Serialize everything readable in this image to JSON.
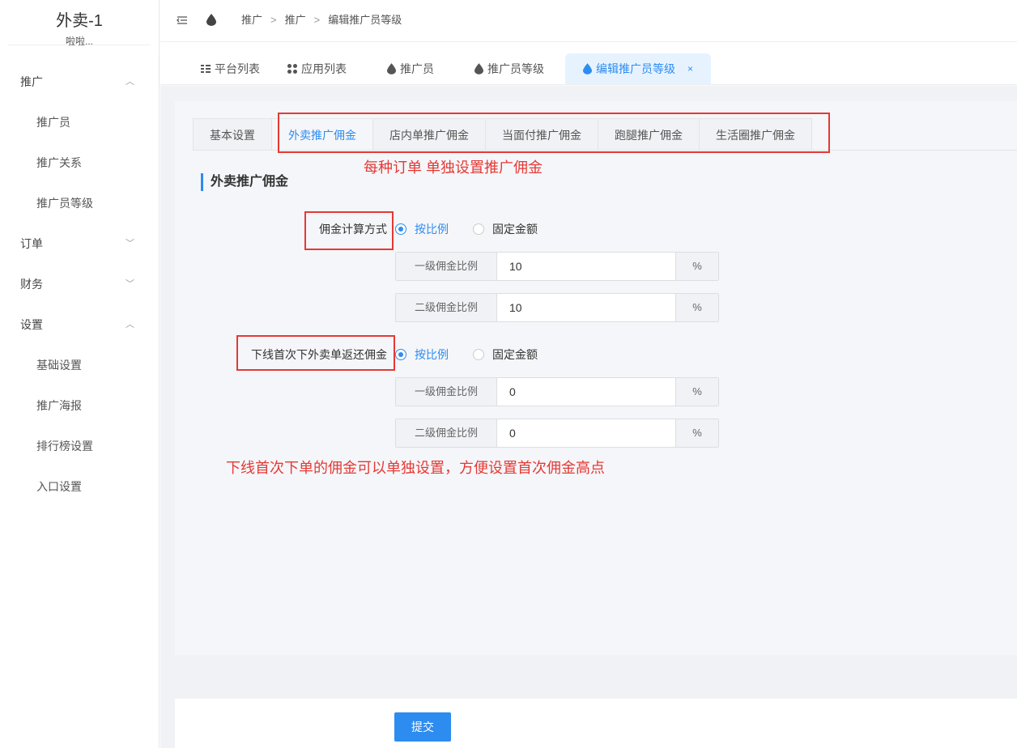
{
  "brand": {
    "title": "外卖-1",
    "subtitle": "啦啦..."
  },
  "sidebar": {
    "groups": [
      {
        "label": "推广",
        "items": [
          "推广员",
          "推广关系",
          "推广员等级"
        ]
      },
      {
        "label": "订单"
      },
      {
        "label": "财务"
      },
      {
        "label": "设置",
        "items": [
          "基础设置",
          "推广海报",
          "排行榜设置",
          "入口设置"
        ]
      }
    ]
  },
  "breadcrumb": [
    "推广",
    "推广",
    "编辑推广员等级"
  ],
  "breadcrumb_sep": ">",
  "view_tabs": [
    {
      "label": "平台列表",
      "icon": "list-icon"
    },
    {
      "label": "应用列表",
      "icon": "grid-icon"
    },
    {
      "label": "推广员",
      "icon": "drop-icon"
    },
    {
      "label": "推广员等级",
      "icon": "drop-icon"
    },
    {
      "label": "编辑推广员等级",
      "icon": "drop-icon",
      "active": true,
      "close": "×"
    }
  ],
  "setting_tabs": [
    "基本设置",
    "外卖推广佣金",
    "店内单推广佣金",
    "当面付推广佣金",
    "跑腿推广佣金",
    "生活圈推广佣金"
  ],
  "active_setting_tab": "外卖推广佣金",
  "section_title": "外卖推广佣金",
  "form": {
    "commission": {
      "label": "佣金计算方式",
      "options": [
        "按比例",
        "固定金额"
      ],
      "selected": "按比例",
      "level1": {
        "label": "一级佣金比例",
        "value": "10",
        "suffix": "%"
      },
      "level2": {
        "label": "二级佣金比例",
        "value": "10",
        "suffix": "%"
      }
    },
    "first_order": {
      "label": "下线首次下外卖单返还佣金",
      "options": [
        "按比例",
        "固定金额"
      ],
      "selected": "按比例",
      "level1": {
        "label": "一级佣金比例",
        "value": "0",
        "suffix": "%"
      },
      "level2": {
        "label": "二级佣金比例",
        "value": "0",
        "suffix": "%"
      }
    }
  },
  "annotations": {
    "tabs_note": "每种订单 单独设置推广佣金",
    "first_order_note": "下线首次下单的佣金可以单独设置，方便设置首次佣金高点"
  },
  "submit_label": "提交",
  "colors": {
    "primary": "#2d8cf0",
    "annotation": "#e53935",
    "background": "#f0f2f5"
  }
}
